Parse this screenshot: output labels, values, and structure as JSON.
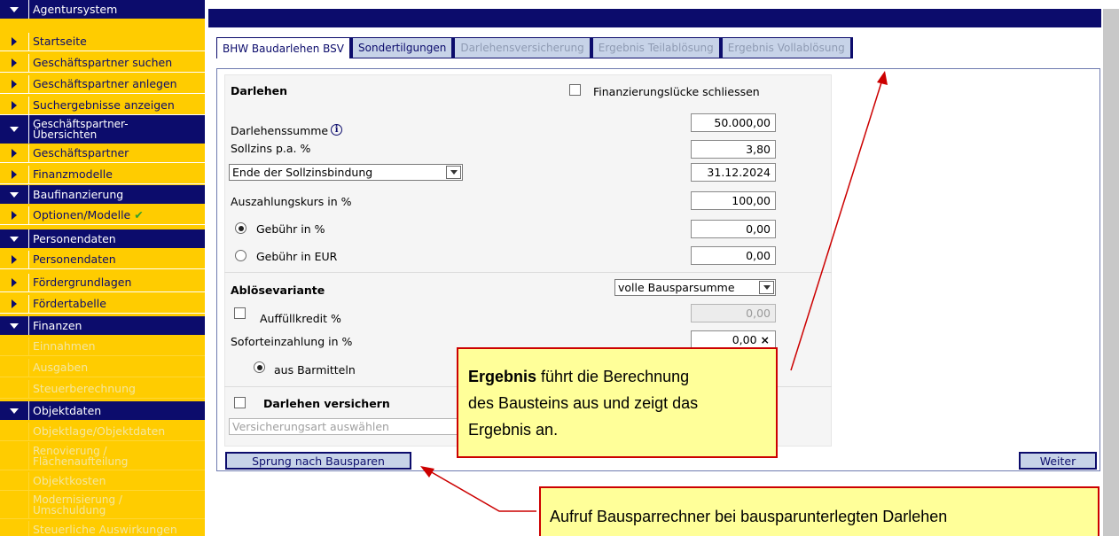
{
  "sidebar": {
    "items": [
      {
        "label": "Agentursystem",
        "type": "section"
      },
      {
        "label": "Startseite",
        "type": "item"
      },
      {
        "label": "Geschäftspartner suchen",
        "type": "item"
      },
      {
        "label": "Geschäftspartner anlegen",
        "type": "item"
      },
      {
        "label": "Suchergebnisse anzeigen",
        "type": "item"
      },
      {
        "label": "Geschäftspartner-",
        "label2": "Übersichten",
        "type": "section"
      },
      {
        "label": "Geschäftspartner",
        "type": "item"
      },
      {
        "label": "Finanzmodelle",
        "type": "item"
      },
      {
        "label": "Baufinanzierung",
        "type": "section"
      },
      {
        "label": "Optionen/Modelle",
        "type": "item"
      },
      {
        "label": "Personendaten",
        "type": "section"
      },
      {
        "label": "Personendaten",
        "type": "item"
      },
      {
        "label": "Fördergrundlagen",
        "type": "item"
      },
      {
        "label": "Fördertabelle",
        "type": "item"
      },
      {
        "label": "Finanzen",
        "type": "section"
      },
      {
        "label": "Einnahmen",
        "type": "disabled"
      },
      {
        "label": "Ausgaben",
        "type": "disabled"
      },
      {
        "label": "Steuerberechnung",
        "type": "disabled"
      },
      {
        "label": "Objektdaten",
        "type": "section"
      },
      {
        "label": "Objektlage/Objektdaten",
        "type": "disabled"
      },
      {
        "label": "Renovierung /",
        "label2": "Flächenaufteilung",
        "type": "disabled"
      },
      {
        "label": "Objektkosten",
        "type": "disabled"
      },
      {
        "label": "Modernisierung /",
        "label2": "Umschuldung",
        "type": "disabled"
      },
      {
        "label": "Steuerliche Auswirkungen",
        "type": "disabled"
      }
    ]
  },
  "tabs": [
    {
      "label": "BHW Baudarlehen BSV",
      "state": "active"
    },
    {
      "label": "Sondertilgungen",
      "state": "enabled"
    },
    {
      "label": "Darlehensversicherung",
      "state": "disabled"
    },
    {
      "label": "Ergebnis Teilablösung",
      "state": "disabled"
    },
    {
      "label": "Ergebnis Vollablösung",
      "state": "disabled"
    }
  ],
  "form": {
    "darlehen_heading": "Darlehen",
    "finanzierungsluecke_label": "Finanzierungslücke schliessen",
    "darlehenssumme_label": "Darlehenssumme",
    "darlehenssumme_value": "50.000,00",
    "info_glyph": "i",
    "sollzins_label": "Sollzins p.a. %",
    "sollzins_value": "3,80",
    "zinsbindung_select": "Ende der Sollzinsbindung",
    "zinsbindung_value": "31.12.2024",
    "auszahlungskurs_label": "Auszahlungskurs in %",
    "auszahlungskurs_value": "100,00",
    "gebuehr_prozent_label": "Gebühr in %",
    "gebuehr_prozent_value": "0,00",
    "gebuehr_eur_label": "Gebühr in EUR",
    "gebuehr_eur_value": "0,00",
    "abloesevariante_label": "Ablösevariante",
    "abloesevariante_select": "volle Bausparsumme",
    "auffuellkredit_label": "Auffüllkredit %",
    "auffuellkredit_value": "0,00",
    "sofort_label": "Soforteinzahlung in %",
    "sofort_value": "0,00",
    "sofort_clear": "×",
    "barmittel_label": "aus Barmitteln",
    "versichern_label": "Darlehen versichern",
    "versicherungsart_placeholder": "Versicherungsart auswählen"
  },
  "buttons": {
    "bausparen": "Sprung nach Bausparen",
    "weiter": "Weiter"
  },
  "callouts": {
    "ergebnis_bold": "Ergebnis",
    "ergebnis_line1": " führt die Berechnung",
    "ergebnis_line2": "des Bausteins aus und zeigt das",
    "ergebnis_line3": "Ergebnis an.",
    "bausparrechner": "Aufruf Bausparrechner bei bausparunterlegten Darlehen"
  },
  "colors": {
    "navy": "#0c0c6c",
    "sidebar_yellow": "#ffcc00",
    "tab_blue": "#c7d3e8",
    "callout_yellow": "#ffff99",
    "annotation_red": "#cc0000"
  }
}
